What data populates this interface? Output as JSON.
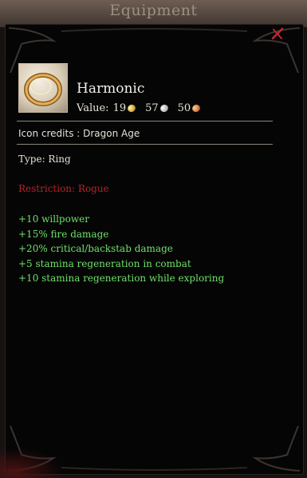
{
  "window": {
    "title": "Equipment"
  },
  "item": {
    "name": "Harmonic",
    "icon": "ring-icon",
    "value_label": "Value:",
    "value": {
      "gold": "19",
      "silver": "57",
      "copper": "50"
    },
    "credits": "Icon credits : Dragon Age",
    "type_line": "Type: Ring",
    "restriction": "Restriction: Rogue",
    "bonuses": [
      "+10 willpower",
      "+15% fire damage",
      "+20% critical/backstab damage",
      "+5 stamina regeneration in combat",
      "+10 stamina regeneration while exploring"
    ]
  },
  "colors": {
    "bonus": "#6fe06a",
    "restriction": "#b1232b",
    "close": "#c1272d"
  }
}
